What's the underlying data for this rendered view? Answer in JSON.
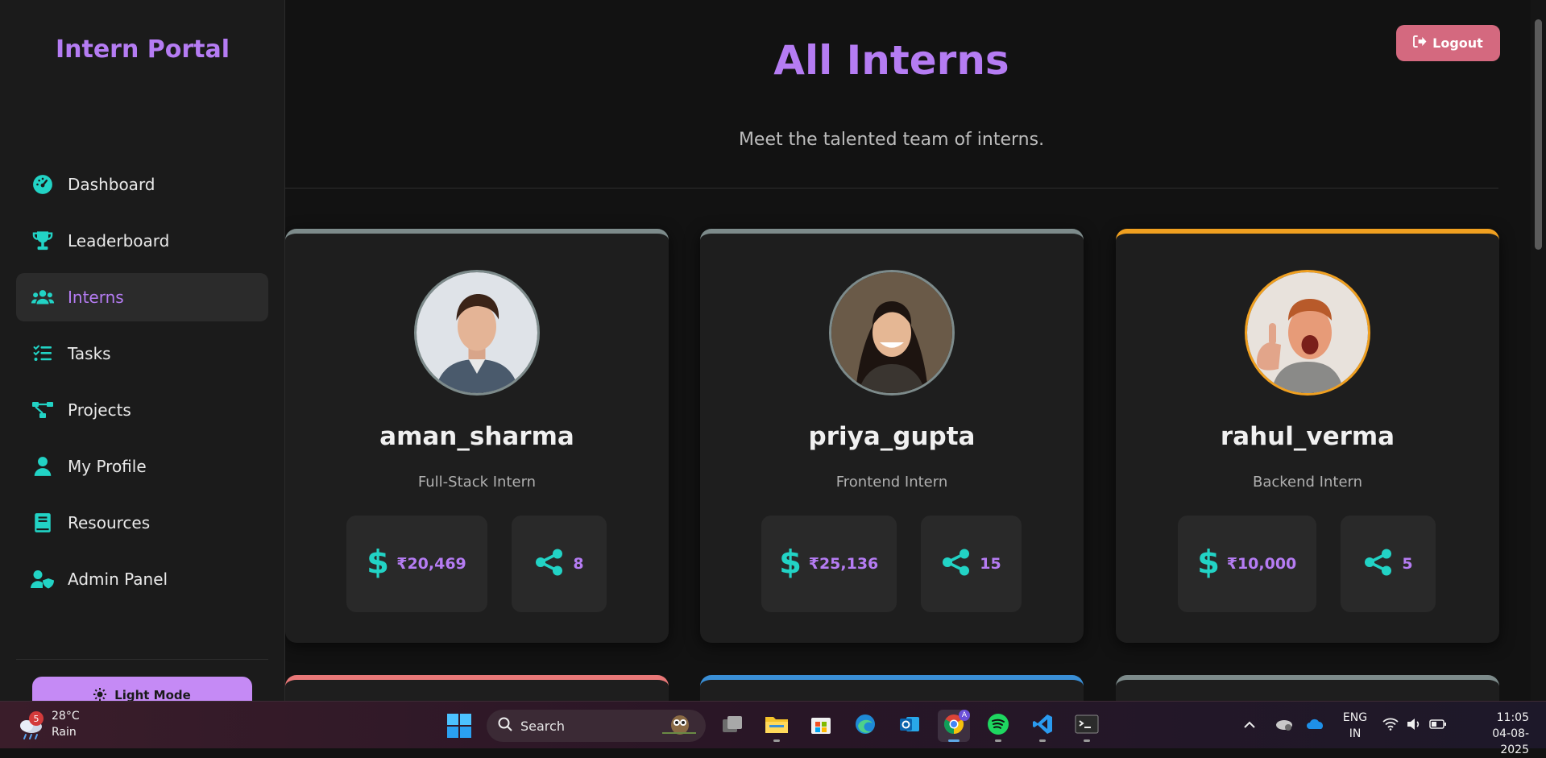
{
  "app": {
    "brand": "Intern Portal"
  },
  "sidebar": {
    "items": [
      {
        "label": "Dashboard",
        "icon": "dashboard-gauge-icon",
        "active": false
      },
      {
        "label": "Leaderboard",
        "icon": "trophy-icon",
        "active": false
      },
      {
        "label": "Interns",
        "icon": "users-icon",
        "active": true
      },
      {
        "label": "Tasks",
        "icon": "tasks-list-icon",
        "active": false
      },
      {
        "label": "Projects",
        "icon": "project-diagram-icon",
        "active": false
      },
      {
        "label": "My Profile",
        "icon": "user-icon",
        "active": false
      },
      {
        "label": "Resources",
        "icon": "book-icon",
        "active": false
      },
      {
        "label": "Admin Panel",
        "icon": "user-shield-icon",
        "active": false
      }
    ],
    "theme_toggle_label": "Light Mode",
    "theme_toggle_icon": "sun-icon"
  },
  "header": {
    "title": "All Interns",
    "subtitle": "Meet the talented team of interns.",
    "logout_label": "Logout",
    "logout_icon": "sign-out-icon"
  },
  "interns": [
    {
      "name": "aman_sharma",
      "role": "Full-Stack Intern",
      "earnings": "₹20,469",
      "referrals": "8",
      "accent": "#7d8b8b"
    },
    {
      "name": "priya_gupta",
      "role": "Frontend Intern",
      "earnings": "₹25,136",
      "referrals": "15",
      "accent": "#7d8b8b"
    },
    {
      "name": "rahul_verma",
      "role": "Backend Intern",
      "earnings": "₹10,000",
      "referrals": "5",
      "accent": "#f0a020"
    }
  ],
  "next_row_accents": [
    "#e97878",
    "#3a8fd6",
    "#7d8b8b"
  ],
  "colors": {
    "accent_purple": "#b57cf3",
    "accent_teal": "#22d3c5",
    "logout_bg": "#d4697f",
    "background": "#121212"
  },
  "taskbar": {
    "weather_temp": "28°C",
    "weather_cond": "Rain",
    "weather_badge": "5",
    "search_label": "Search",
    "lang_line1": "ENG",
    "lang_line2": "IN",
    "time": "11:05",
    "date": "04-08-2025",
    "chrome_badge": "A"
  }
}
